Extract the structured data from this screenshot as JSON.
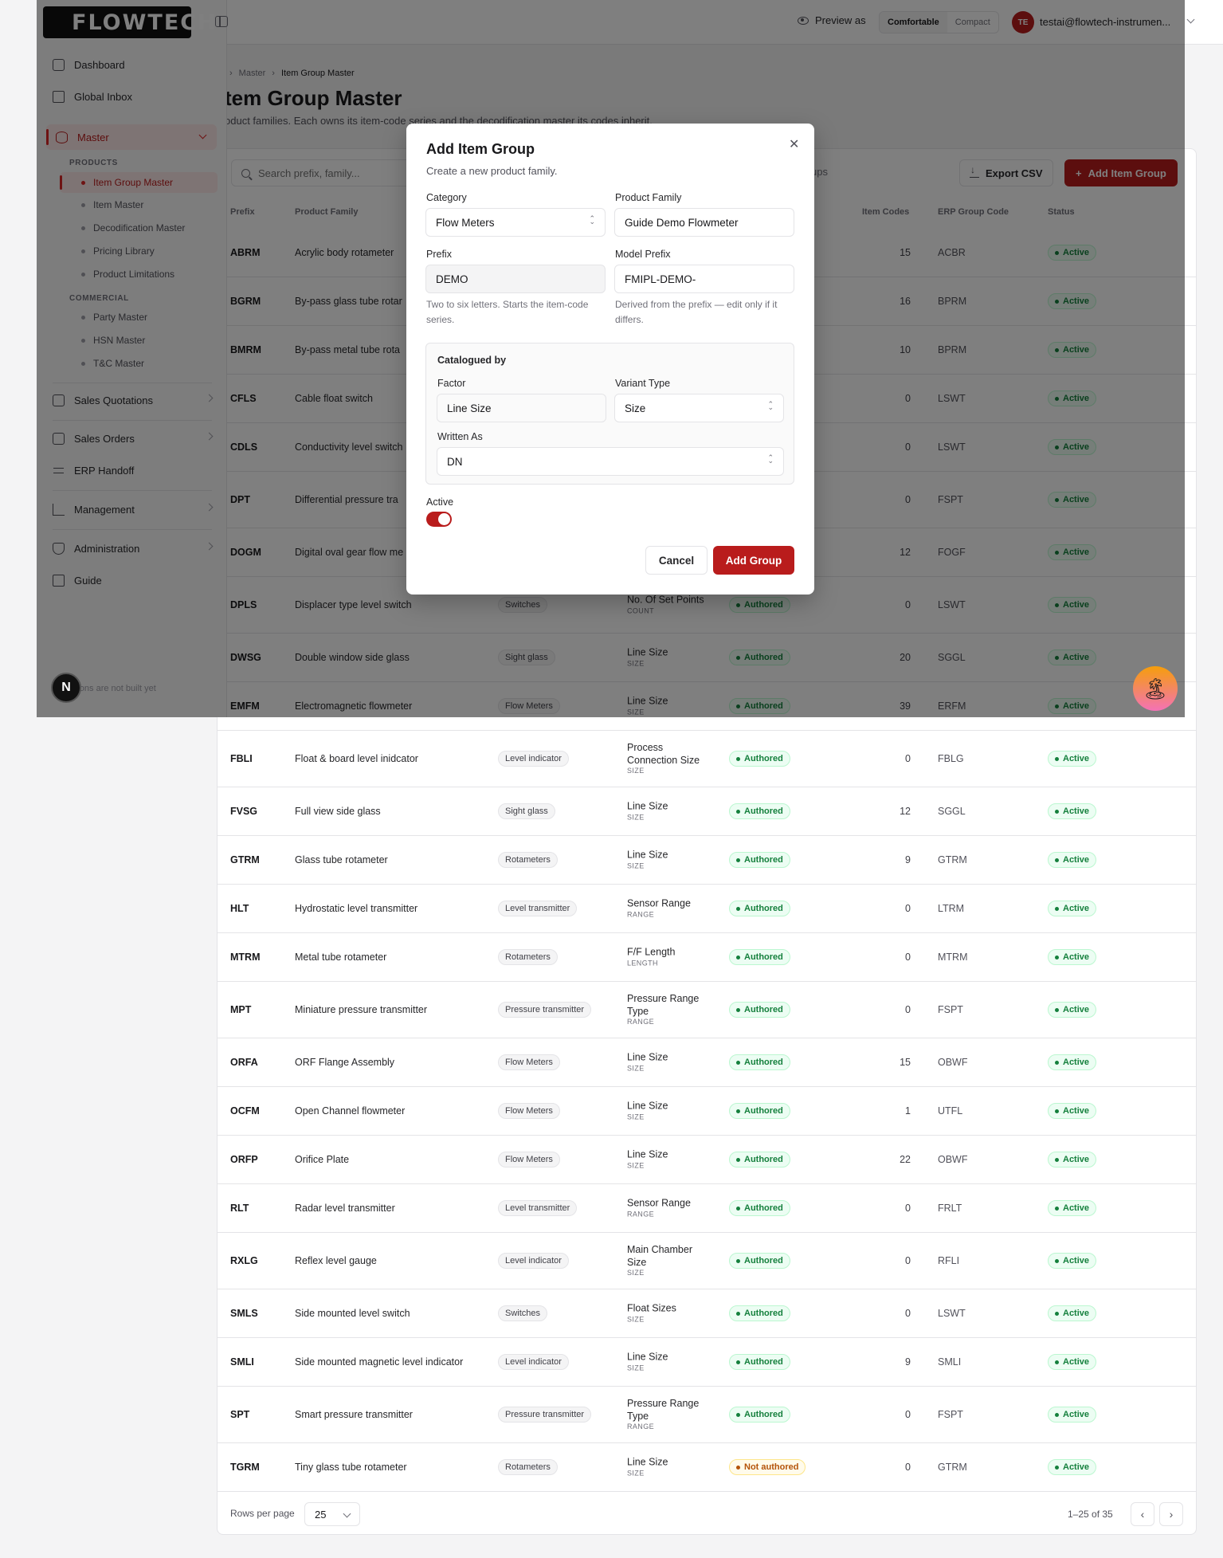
{
  "brand": {
    "logo_text": "FLOWTECH",
    "accent": "#b91c1c"
  },
  "topbar": {
    "preview_label": "Preview as",
    "density": [
      "Comfortable",
      "Compact"
    ],
    "avatar_initials": "TE",
    "user_email": "testai@flowtech-instrumen..."
  },
  "sidebar": {
    "items": [
      "Dashboard",
      "Global Inbox",
      "Master"
    ],
    "products_label": "PRODUCTS",
    "products": [
      "Item Group Master",
      "Item Master",
      "Decodification Master",
      "Pricing Library",
      "Product Limitations"
    ],
    "commercial_label": "COMMERCIAL",
    "commercial": [
      "Party Master",
      "HSN Master",
      "T&C Master"
    ],
    "lower": [
      "Sales Quotations",
      "Sales Orders",
      "ERP Handoff",
      "Management",
      "Administration",
      "Guide"
    ],
    "footer_note": "d sections are not built yet",
    "badge": "N"
  },
  "page": {
    "breadcrumb": [
      "Master",
      "Item Group Master"
    ],
    "title": "tem Group Master",
    "subtitle": "oduct families. Each owns its item-code series and the decodification master its codes inherit."
  },
  "toolbar": {
    "search_placeholder": "Search prefix, family...",
    "groups_filter": "ups",
    "export_label": "Export CSV",
    "add_label": "Add Item Group"
  },
  "table": {
    "headers": [
      "Prefix",
      "Product Family",
      "er",
      "Item Codes",
      "ERP Group Code",
      "Status"
    ],
    "rows": [
      {
        "prefix": "ABRM",
        "family": "Acrylic body rotameter",
        "category": "",
        "factor": "",
        "factor_kind": "",
        "decod": "",
        "codes": "15",
        "erp": "ACBR",
        "status": "Active"
      },
      {
        "prefix": "BGRM",
        "family": "By-pass glass tube rotar",
        "category": "",
        "factor": "",
        "factor_kind": "",
        "decod": "",
        "codes": "16",
        "erp": "BPRM",
        "status": "Active"
      },
      {
        "prefix": "BMRM",
        "family": "By-pass metal tube rota",
        "category": "",
        "factor": "",
        "factor_kind": "",
        "decod": "",
        "codes": "10",
        "erp": "BPRM",
        "status": "Active"
      },
      {
        "prefix": "CFLS",
        "family": "Cable float switch",
        "category": "",
        "factor": "",
        "factor_kind": "",
        "decod": "",
        "codes": "0",
        "erp": "LSWT",
        "status": "Active"
      },
      {
        "prefix": "CDLS",
        "family": "Conductivity level switch",
        "category": "",
        "factor": "",
        "factor_kind": "",
        "decod": "",
        "codes": "0",
        "erp": "LSWT",
        "status": "Active"
      },
      {
        "prefix": "DPT",
        "family": "Differential pressure tra",
        "category": "",
        "factor": "",
        "factor_kind": "",
        "decod": "",
        "codes": "0",
        "erp": "FSPT",
        "status": "Active"
      },
      {
        "prefix": "DOGM",
        "family": "Digital oval gear flow me",
        "category": "",
        "factor": "",
        "factor_kind": "",
        "decod": "",
        "codes": "12",
        "erp": "FOGF",
        "status": "Active"
      },
      {
        "prefix": "DPLS",
        "family": "Displacer type level switch",
        "category": "Switches",
        "factor": "No. Of Set Points",
        "factor_kind": "COUNT",
        "decod": "Authored",
        "codes": "0",
        "erp": "LSWT",
        "status": "Active"
      },
      {
        "prefix": "DWSG",
        "family": "Double window side glass",
        "category": "Sight glass",
        "factor": "Line Size",
        "factor_kind": "SIZE",
        "decod": "Authored",
        "codes": "20",
        "erp": "SGGL",
        "status": "Active"
      },
      {
        "prefix": "EMFM",
        "family": "Electromagnetic flowmeter",
        "category": "Flow Meters",
        "factor": "Line Size",
        "factor_kind": "SIZE",
        "decod": "Authored",
        "codes": "39",
        "erp": "ERFM",
        "status": "Active"
      },
      {
        "prefix": "FBLI",
        "family": "Float & board level inidcator",
        "category": "Level indicator",
        "factor": "Process Connection Size",
        "factor_kind": "SIZE",
        "decod": "Authored",
        "codes": "0",
        "erp": "FBLG",
        "status": "Active"
      },
      {
        "prefix": "FVSG",
        "family": "Full view side glass",
        "category": "Sight glass",
        "factor": "Line Size",
        "factor_kind": "SIZE",
        "decod": "Authored",
        "codes": "12",
        "erp": "SGGL",
        "status": "Active"
      },
      {
        "prefix": "GTRM",
        "family": "Glass tube rotameter",
        "category": "Rotameters",
        "factor": "Line Size",
        "factor_kind": "SIZE",
        "decod": "Authored",
        "codes": "9",
        "erp": "GTRM",
        "status": "Active"
      },
      {
        "prefix": "HLT",
        "family": "Hydrostatic level transmitter",
        "category": "Level transmitter",
        "factor": "Sensor Range",
        "factor_kind": "RANGE",
        "decod": "Authored",
        "codes": "0",
        "erp": "LTRM",
        "status": "Active"
      },
      {
        "prefix": "MTRM",
        "family": "Metal tube rotameter",
        "category": "Rotameters",
        "factor": "F/F Length",
        "factor_kind": "LENGTH",
        "decod": "Authored",
        "codes": "0",
        "erp": "MTRM",
        "status": "Active"
      },
      {
        "prefix": "MPT",
        "family": "Miniature pressure transmitter",
        "category": "Pressure transmitter",
        "factor": "Pressure Range Type",
        "factor_kind": "RANGE",
        "decod": "Authored",
        "codes": "0",
        "erp": "FSPT",
        "status": "Active"
      },
      {
        "prefix": "ORFA",
        "family": "ORF Flange Assembly",
        "category": "Flow Meters",
        "factor": "Line Size",
        "factor_kind": "SIZE",
        "decod": "Authored",
        "codes": "15",
        "erp": "OBWF",
        "status": "Active"
      },
      {
        "prefix": "OCFM",
        "family": "Open Channel flowmeter",
        "category": "Flow Meters",
        "factor": "Line Size",
        "factor_kind": "SIZE",
        "decod": "Authored",
        "codes": "1",
        "erp": "UTFL",
        "status": "Active"
      },
      {
        "prefix": "ORFP",
        "family": "Orifice Plate",
        "category": "Flow Meters",
        "factor": "Line Size",
        "factor_kind": "SIZE",
        "decod": "Authored",
        "codes": "22",
        "erp": "OBWF",
        "status": "Active"
      },
      {
        "prefix": "RLT",
        "family": "Radar level transmitter",
        "category": "Level transmitter",
        "factor": "Sensor Range",
        "factor_kind": "RANGE",
        "decod": "Authored",
        "codes": "0",
        "erp": "FRLT",
        "status": "Active"
      },
      {
        "prefix": "RXLG",
        "family": "Reflex level gauge",
        "category": "Level indicator",
        "factor": "Main Chamber Size",
        "factor_kind": "SIZE",
        "decod": "Authored",
        "codes": "0",
        "erp": "RFLI",
        "status": "Active"
      },
      {
        "prefix": "SMLS",
        "family": "Side mounted level switch",
        "category": "Switches",
        "factor": "Float Sizes",
        "factor_kind": "SIZE",
        "decod": "Authored",
        "codes": "0",
        "erp": "LSWT",
        "status": "Active"
      },
      {
        "prefix": "SMLI",
        "family": "Side mounted magnetic level indicator",
        "category": "Level indicator",
        "factor": "Line Size",
        "factor_kind": "SIZE",
        "decod": "Authored",
        "codes": "9",
        "erp": "SMLI",
        "status": "Active"
      },
      {
        "prefix": "SPT",
        "family": "Smart pressure transmitter",
        "category": "Pressure transmitter",
        "factor": "Pressure Range Type",
        "factor_kind": "RANGE",
        "decod": "Authored",
        "codes": "0",
        "erp": "FSPT",
        "status": "Active"
      },
      {
        "prefix": "TGRM",
        "family": "Tiny glass tube rotameter",
        "category": "Rotameters",
        "factor": "Line Size",
        "factor_kind": "SIZE",
        "decod": "Not authored",
        "codes": "0",
        "erp": "GTRM",
        "status": "Active"
      }
    ]
  },
  "pagination": {
    "rows_label": "Rows per page",
    "rows_value": "25",
    "range": "1–25 of 35"
  },
  "modal": {
    "title": "Add Item Group",
    "subtitle": "Create a new product family.",
    "category_label": "Category",
    "category_value": "Flow Meters",
    "family_label": "Product Family",
    "family_value": "Guide Demo Flowmeter",
    "prefix_label": "Prefix",
    "prefix_value": "DEMO",
    "prefix_help": "Two to six letters. Starts the item-code series.",
    "model_label": "Model Prefix",
    "model_value": "FMIPL-DEMO-",
    "model_help": "Derived from the prefix — edit only if it differs.",
    "catalogued_title": "Catalogued by",
    "factor_label": "Factor",
    "factor_value": "Line Size",
    "variant_label": "Variant Type",
    "variant_value": "Size",
    "written_label": "Written As",
    "written_value": "DN",
    "active_label": "Active",
    "active_on": true,
    "cancel": "Cancel",
    "submit": "Add Group"
  }
}
